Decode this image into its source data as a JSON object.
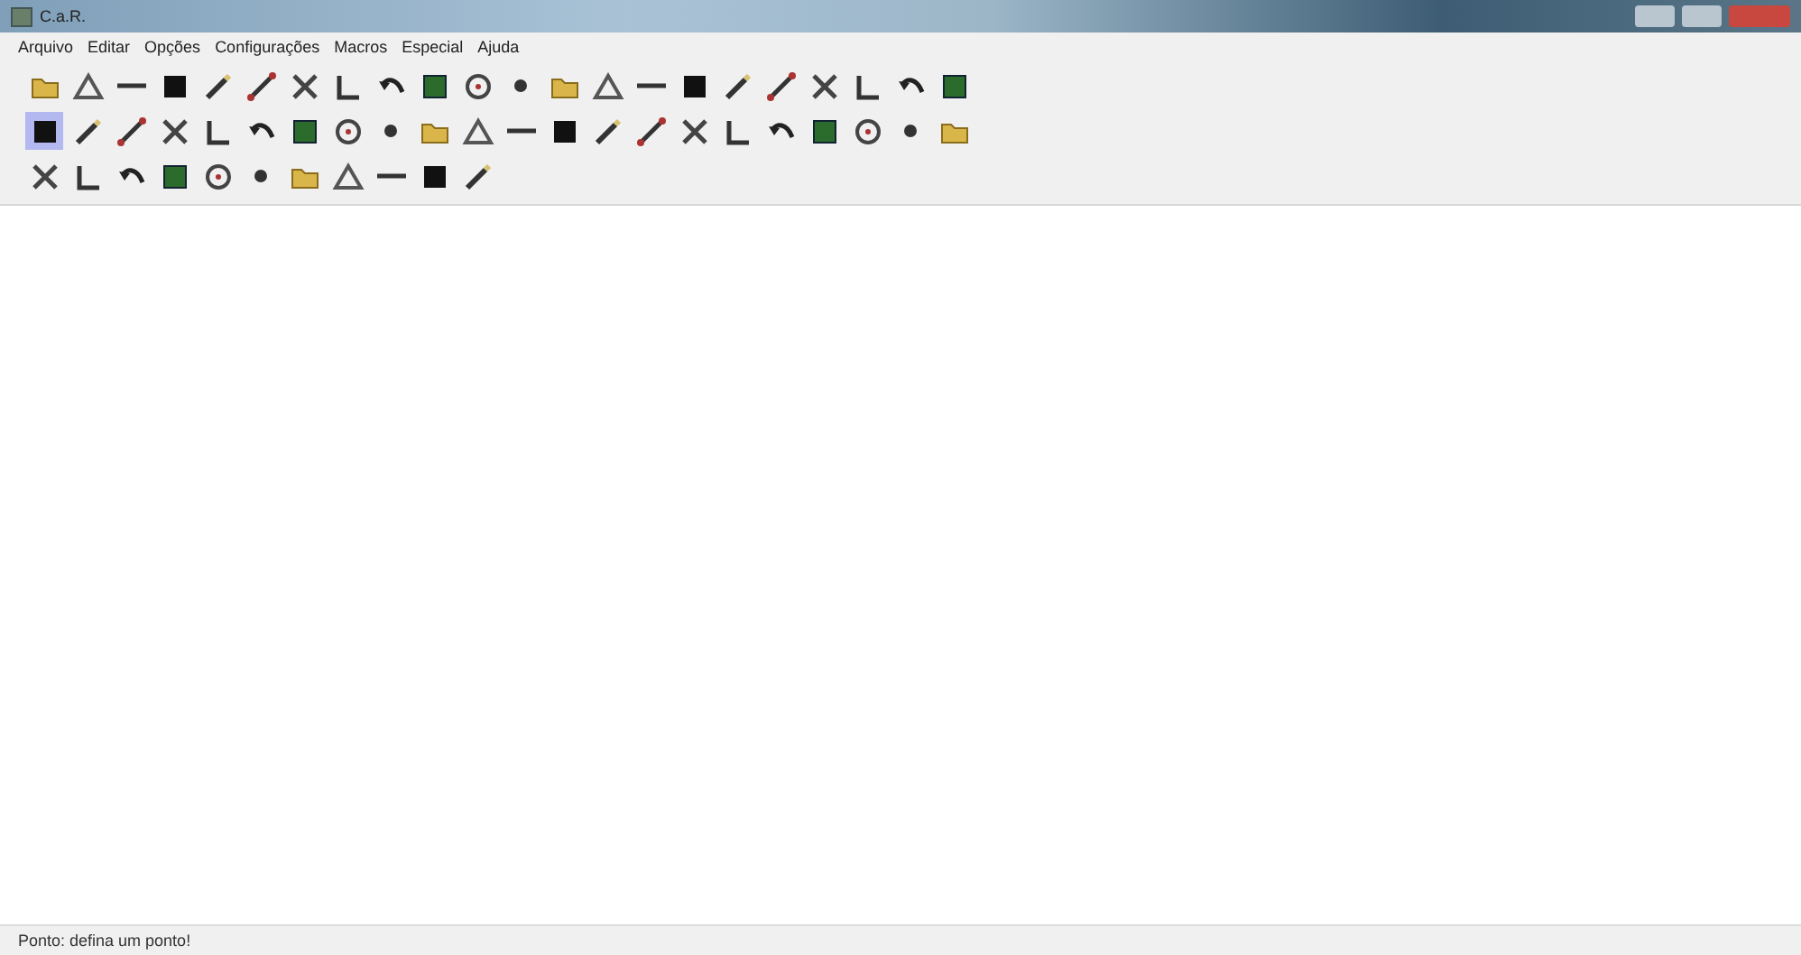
{
  "window": {
    "title": "C.a.R."
  },
  "menu": [
    "Arquivo",
    "Editar",
    "Opções",
    "Configurações",
    "Macros",
    "Especial",
    "Ajuda"
  ],
  "toolbars": [
    {
      "tools": [
        {
          "selected": false
        },
        {
          "selected": false
        },
        {
          "selected": false
        },
        {
          "selected": false
        },
        {
          "selected": false
        },
        {
          "selected": false
        },
        {
          "selected": false
        },
        {
          "selected": false
        },
        {
          "selected": false
        },
        {
          "selected": false
        },
        {
          "selected": false
        },
        {
          "selected": false
        },
        {
          "selected": false
        },
        {
          "selected": false
        },
        {
          "selected": false
        },
        {
          "selected": false
        },
        {
          "selected": false
        },
        {
          "selected": false
        },
        {
          "selected": false
        },
        {
          "selected": false
        },
        {
          "selected": false
        },
        {
          "selected": false
        }
      ]
    },
    {
      "tools": [
        {
          "selected": true
        },
        {
          "selected": false
        },
        {
          "selected": false
        },
        {
          "selected": false
        },
        {
          "selected": false
        },
        {
          "selected": false
        },
        {
          "selected": false
        },
        {
          "selected": false
        },
        {
          "selected": false
        },
        {
          "selected": false
        },
        {
          "selected": false
        },
        {
          "selected": false
        },
        {
          "selected": false
        },
        {
          "selected": false
        },
        {
          "selected": false
        },
        {
          "selected": false
        },
        {
          "selected": false
        },
        {
          "selected": false
        },
        {
          "selected": false
        },
        {
          "selected": false
        },
        {
          "selected": false
        },
        {
          "selected": false
        }
      ]
    },
    {
      "tools": [
        {
          "selected": false
        },
        {
          "selected": false
        },
        {
          "selected": false
        },
        {
          "selected": false
        },
        {
          "selected": false
        },
        {
          "selected": false
        },
        {
          "selected": false
        },
        {
          "selected": false
        },
        {
          "selected": false
        },
        {
          "selected": false
        },
        {
          "selected": false
        }
      ]
    }
  ],
  "status_bar": "Ponto: defina um ponto!"
}
